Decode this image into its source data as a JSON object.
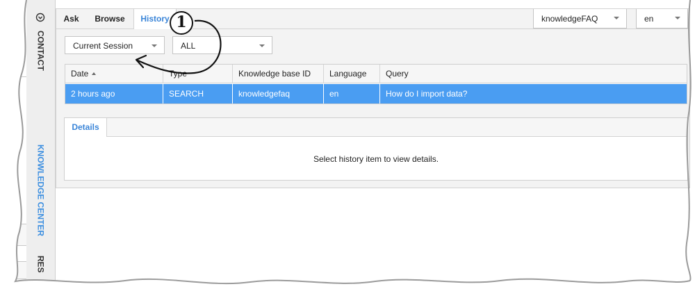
{
  "rail": {
    "contact_label": "CONTACT",
    "knowledge_label": "KNOWLEDGE CENTER",
    "res_label": "RES"
  },
  "tabs": {
    "ask": "Ask",
    "browse": "Browse",
    "history": "History",
    "active": "History"
  },
  "knowledge_base": {
    "selected": "knowledgeFAQ"
  },
  "language": {
    "selected": "en"
  },
  "filters": {
    "session": "Current Session",
    "type": "ALL"
  },
  "table": {
    "columns": [
      "Date",
      "Type",
      "Knowledge base ID",
      "Language",
      "Query"
    ],
    "sort": {
      "column": "Date",
      "direction": "ascending"
    },
    "rows": [
      {
        "date": "2 hours ago",
        "type": "SEARCH",
        "kb_id": "knowledgefaq",
        "language": "en",
        "query": "How do I import data?",
        "selected": true
      }
    ]
  },
  "details": {
    "tab": "Details",
    "empty_message": "Select history item to view details."
  },
  "annotation": {
    "number": "1"
  },
  "colors": {
    "accent": "#3a85d8",
    "selected_row": "#4a9df2"
  }
}
